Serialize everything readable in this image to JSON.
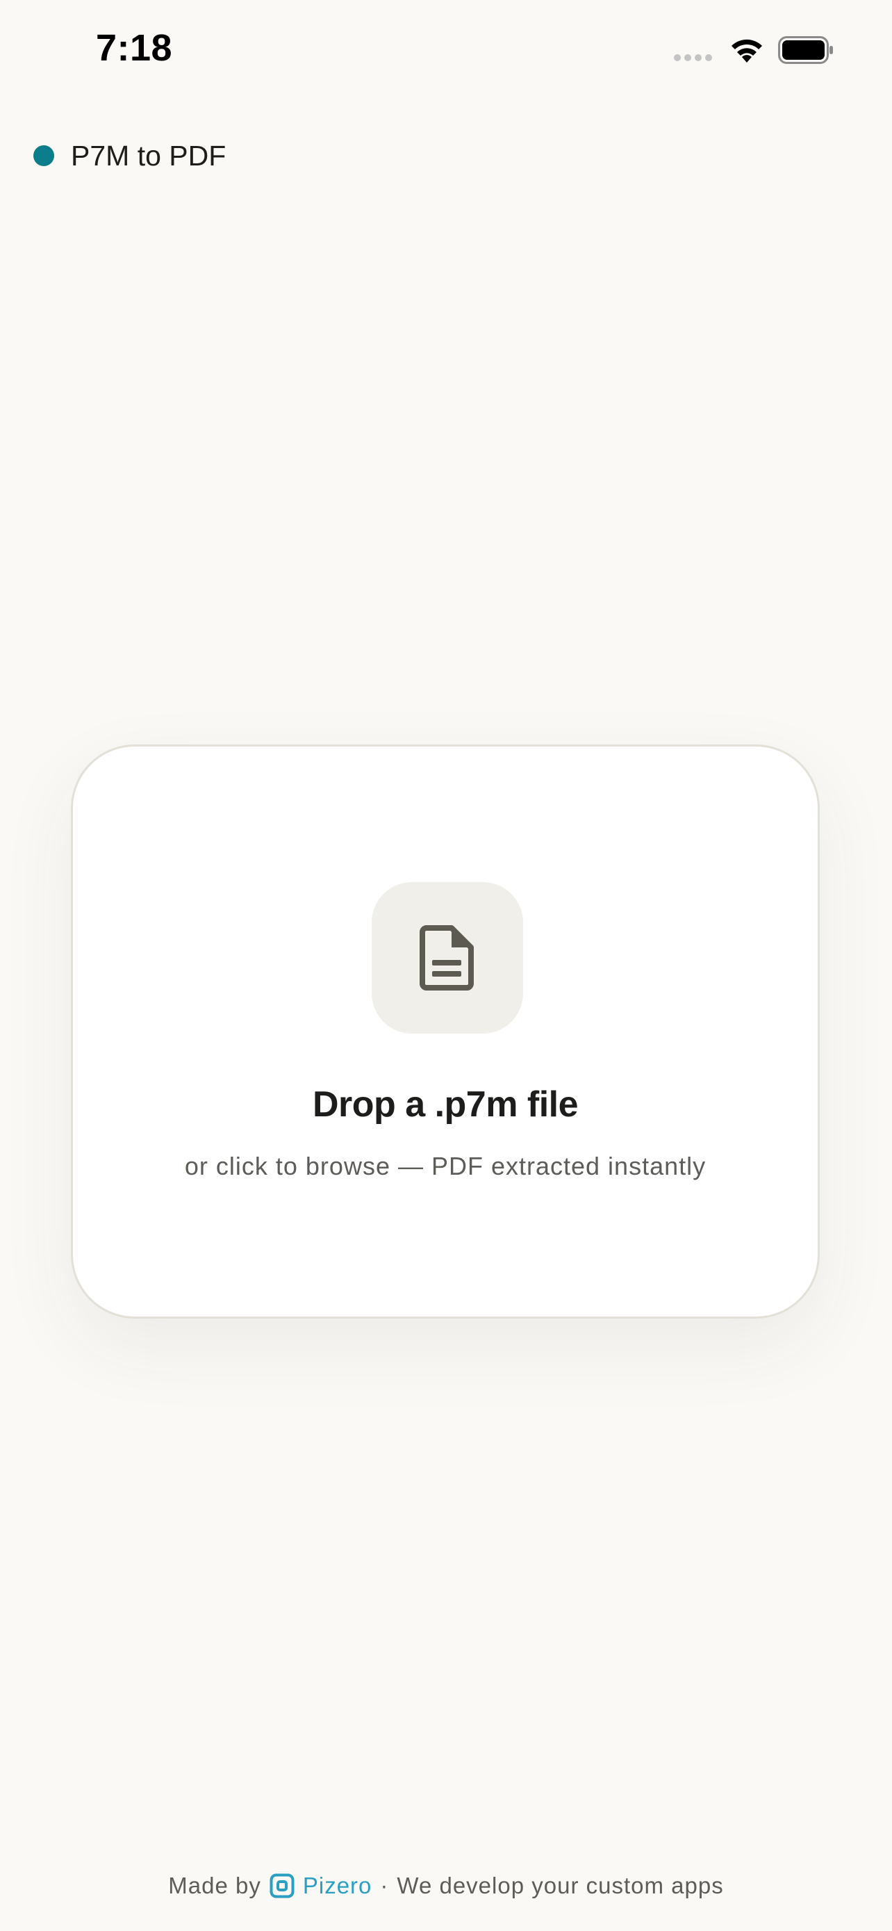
{
  "status_bar": {
    "time": "7:18",
    "icons": [
      "signal-dots-icon",
      "wifi-icon",
      "battery-icon"
    ]
  },
  "header": {
    "title": "P7M to PDF",
    "dot_color": "#0c7d8a"
  },
  "drop_zone": {
    "icon": "document-icon",
    "title": "Drop a .p7m file",
    "subtitle": "or click to browse — PDF extracted instantly"
  },
  "footer": {
    "made_by": "Made by",
    "brand": "Pizero",
    "brand_icon": "pizero-logo-icon",
    "separator": "·",
    "tagline": "We develop your custom apps",
    "brand_color": "#2a9fc2"
  }
}
